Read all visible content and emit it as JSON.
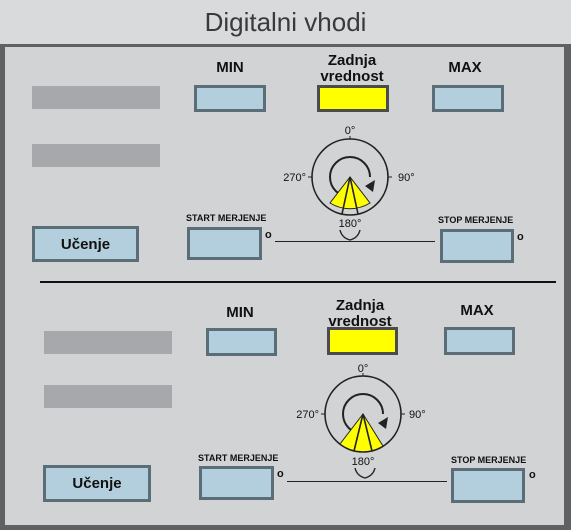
{
  "title": "Digitalni vhodi",
  "headers": {
    "min": "MIN",
    "last": "Zadnja vrednost",
    "max": "MAX"
  },
  "buttons": {
    "learn": "Učenje"
  },
  "labels": {
    "start": "START MERJENJE",
    "stop": "STOP MERJENJE",
    "degree": "o"
  },
  "dial": {
    "top": "0°",
    "right": "90°",
    "bottom": "180°",
    "left": "270°"
  },
  "colors": {
    "field": "#b3cfdd",
    "highlight": "#ffff00",
    "placeholder": "#a6a8ab"
  }
}
